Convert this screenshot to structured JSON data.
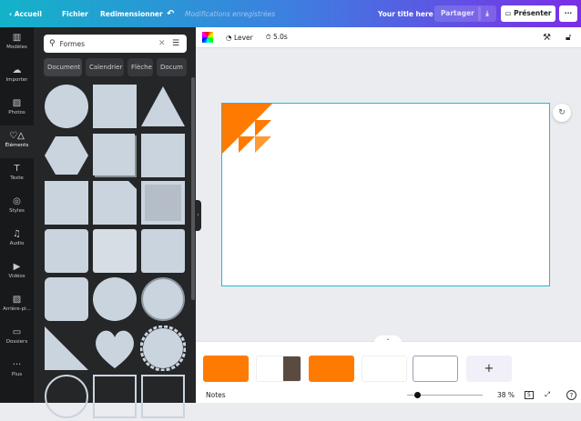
{
  "topbar": {
    "home": "Accueil",
    "file": "Fichier",
    "resize": "Redimensionner",
    "status": "Modifications enregistrées",
    "title": "Your title here",
    "share": "Partager",
    "present": "Présenter",
    "more": "···"
  },
  "rail": [
    {
      "label": "Modèles",
      "icon": "▥"
    },
    {
      "label": "Importer",
      "icon": "☁"
    },
    {
      "label": "Photos",
      "icon": "▨"
    },
    {
      "label": "Éléments",
      "icon": "♡△"
    },
    {
      "label": "Texte",
      "icon": "T"
    },
    {
      "label": "Styles",
      "icon": "◎"
    },
    {
      "label": "Audio",
      "icon": "♫"
    },
    {
      "label": "Vidéos",
      "icon": "▶"
    },
    {
      "label": "Arrière-pl...",
      "icon": "▨"
    },
    {
      "label": "Dossiers",
      "icon": "▭"
    },
    {
      "label": "Plus",
      "icon": "···"
    }
  ],
  "panel": {
    "search_value": "Formes",
    "chips": [
      "Document",
      "Calendrier",
      "Flèche",
      "Docum"
    ]
  },
  "toolbar": {
    "lift": "Lever",
    "duration": "5.0s"
  },
  "strip": {
    "add": "+"
  },
  "bottom": {
    "notes": "Notes",
    "zoom": "38 %",
    "zoom_fraction": 0.1,
    "page": "5",
    "help": "?"
  },
  "colors": {
    "accent": "#ff7a00",
    "selection": "#22b8d6",
    "shape": "#c9d4df"
  }
}
